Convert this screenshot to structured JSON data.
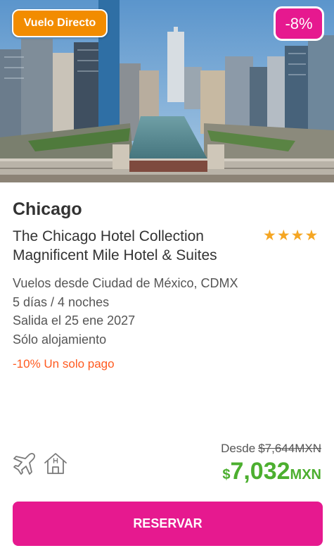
{
  "badges": {
    "direct_flight": "Vuelo Directo",
    "discount": "-8%"
  },
  "hero": {
    "image": "chicago-river-skyline"
  },
  "card": {
    "city": "Chicago",
    "hotel_name": "The Chicago Hotel Collection Magnificent Mile Hotel & Suites",
    "star_rating": 4,
    "details": [
      "Vuelos desde Ciudad de México, CDMX",
      "5 días / 4 noches",
      "Salida el 25 ene 2027",
      "Sólo alojamiento"
    ],
    "promo": "-10% Un solo pago"
  },
  "includes_icons": [
    "airplane-icon",
    "hotel-icon"
  ],
  "pricing": {
    "from_label": "Desde",
    "old_price": "$7,644MXN",
    "currency_symbol": "$",
    "amount": "7,032",
    "currency_code": "MXN"
  },
  "cta": {
    "label": "RESERVAR"
  },
  "colors": {
    "brand_pink": "#e6198f",
    "badge_orange": "#f28c00",
    "promo_orange": "#ff5a1f",
    "price_green": "#4caf2f",
    "star": "#f5a623"
  }
}
